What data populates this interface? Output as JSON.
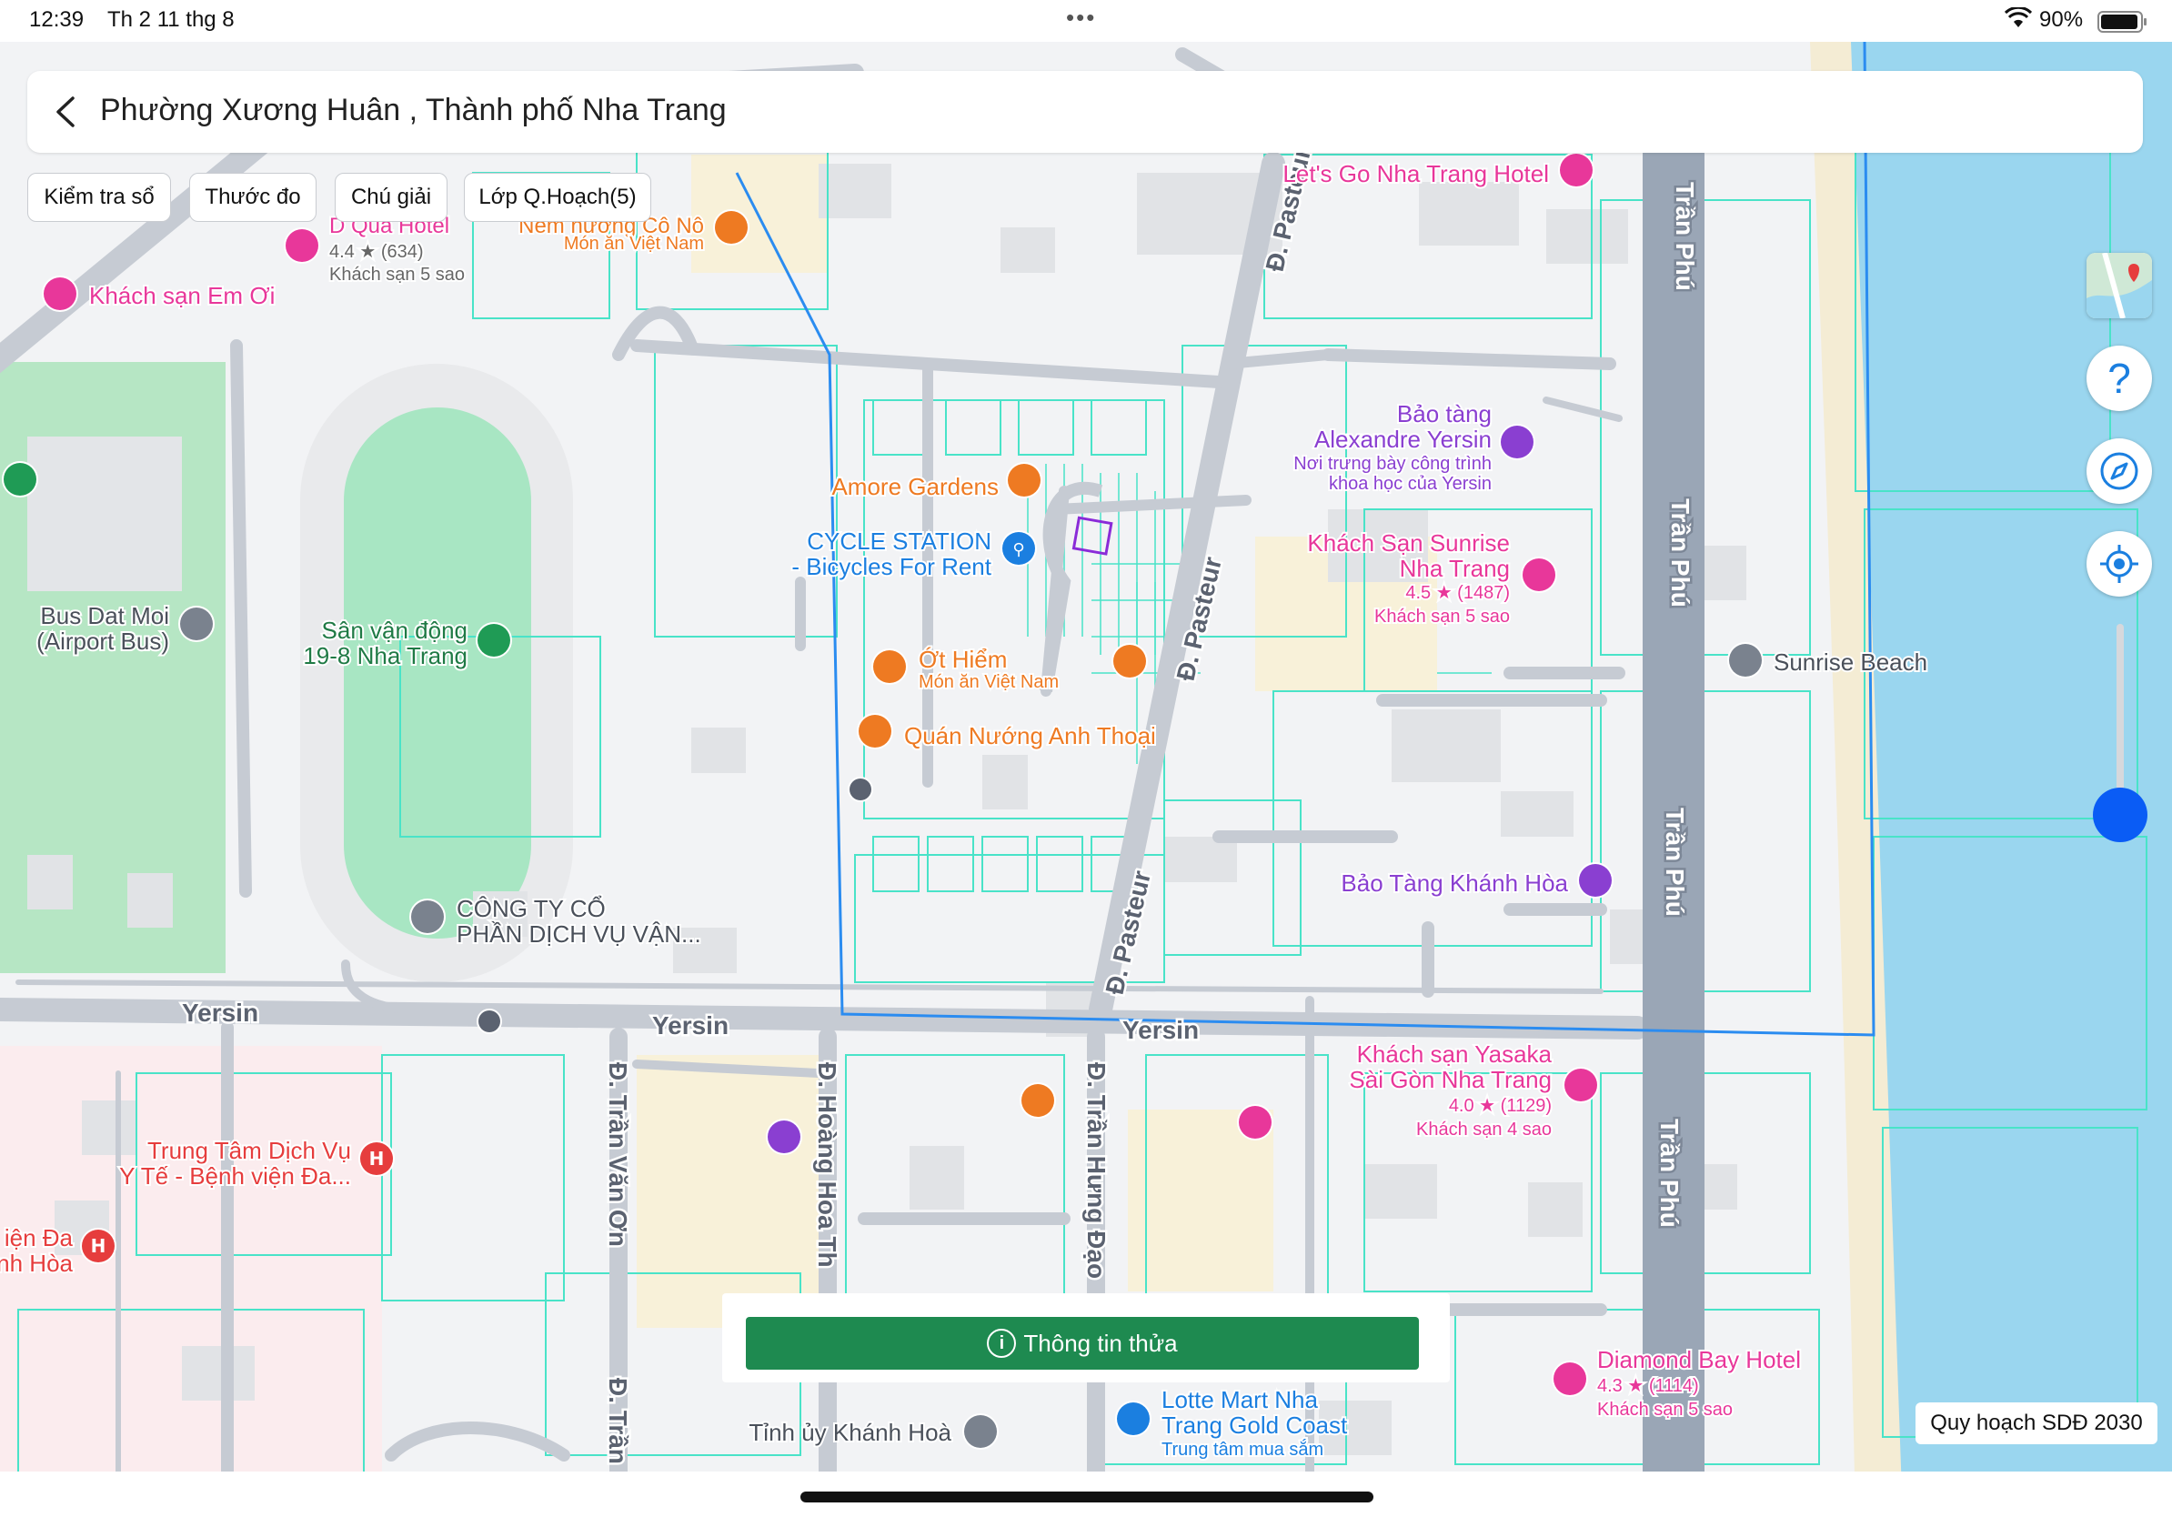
{
  "status_bar": {
    "time": "12:39",
    "date": "Th 2 11 thg 8",
    "battery": "90%"
  },
  "header": {
    "title": "Phường Xương Huân , Thành phố Nha Trang"
  },
  "toolbar": {
    "check_label": "Kiểm tra sổ",
    "ruler_label": "Thước đo",
    "legend_label": "Chú giải",
    "layer_label": "Lớp Q.Hoạch(5)"
  },
  "side_controls": {
    "help": "?"
  },
  "info_button": {
    "label": "Thông tin thửa"
  },
  "plan_label": "Quy hoạch SDĐ 2030",
  "colors": {
    "accent_green": "#1e8a50",
    "boundary_blue": "#2b8cf0",
    "parcel_cyan": "#49e3c8",
    "sea": "#9ad6ef",
    "stadium": "#a8e6c3",
    "poi_pink": "#e8379a",
    "poi_orange": "#ee7a22",
    "poi_purple": "#8a3fd1"
  },
  "map": {
    "streets": [
      "Yersin",
      "Yersin",
      "Yersin",
      "Đ. Pasteur",
      "Đ. Pasteur",
      "Đ. Pasteur",
      "Trần Phú",
      "Trần Phú",
      "Trần Phú",
      "Trần Phú",
      "Đ. Trần Văn Ơn",
      "Đ. Hoàng Hoa Th",
      "Đ. Trần Hưng Đạo",
      "Đ. Trần"
    ],
    "pois": [
      {
        "name": "Let's Go Nha Trang Hotel",
        "icon": "hotel-icon"
      },
      {
        "name": "D Qua Hotel",
        "sub": "4.4 ★ (634)",
        "sub2": "Khách sạn 5 sao",
        "icon": "hotel-icon"
      },
      {
        "name": "Khách sạn Em Ơi",
        "icon": "hotel-icon"
      },
      {
        "name": "Nem nướng Cô Nô",
        "sub": "Món ăn Việt Nam",
        "icon": "restaurant-icon"
      },
      {
        "name": "Bảo tàng",
        "name2": "Alexandre Yersin",
        "sub": "Nơi trưng bày công trình",
        "sub2": "khoa học của Yersin",
        "icon": "museum-icon"
      },
      {
        "name": "Amore Gardens",
        "icon": "cafe-icon"
      },
      {
        "name": "CYCLE STATION",
        "name2": "- Bicycles For Rent",
        "icon": "bicycle-icon"
      },
      {
        "name": "Khách Sạn Sunrise",
        "name2": "Nha Trang",
        "sub": "4.5 ★ (1487)",
        "sub2": "Khách sạn 5 sao",
        "icon": "hotel-icon"
      },
      {
        "name": "Bus Dat Moi",
        "name2": "(Airport Bus)",
        "icon": "place-icon"
      },
      {
        "name": "Sân vận động",
        "name2": "19-8 Nha Trang",
        "icon": "stadium-icon"
      },
      {
        "name": "Ớt Hiểm",
        "sub": "Món ăn Việt Nam",
        "icon": "restaurant-icon"
      },
      {
        "name": "Quán Nướng Anh Thoại",
        "icon": "restaurant-icon"
      },
      {
        "name": "Sunrise Beach",
        "icon": "place-icon"
      },
      {
        "name": "Bảo Tàng Khánh Hòa",
        "icon": "museum-icon"
      },
      {
        "name": "CÔNG TY CỔ",
        "name2": "PHẦN DỊCH VỤ VẬN...",
        "icon": "place-icon"
      },
      {
        "name": "Khách sạn Yasaka",
        "name2": "Sài Gòn Nha Trang",
        "sub": "4.0 ★ (1129)",
        "sub2": "Khách sạn 4 sao",
        "icon": "hotel-icon"
      },
      {
        "name": "Trung Tâm Dịch Vụ",
        "name2": "Y Tế - Bệnh viện Đa...",
        "icon": "hospital-icon"
      },
      {
        "name": "iện Đa",
        "name2": "nh Hòa",
        "icon": "hospital-icon"
      },
      {
        "name": "Diamond Bay Hotel",
        "sub": "4.3 ★ (1114)",
        "sub2": "Khách sạn 5 sao",
        "icon": "hotel-icon"
      },
      {
        "name": "Lotte Mart Nha",
        "name2": "Trang Gold Coast",
        "sub": "Trung tâm mua sắm",
        "icon": "shopping-icon"
      },
      {
        "name": "Tỉnh ủy Khánh Hoà",
        "icon": "place-icon"
      }
    ]
  }
}
